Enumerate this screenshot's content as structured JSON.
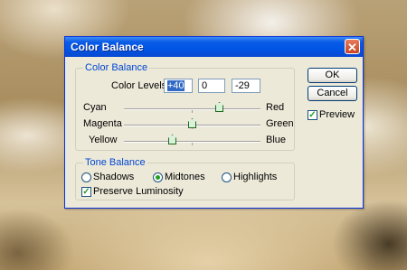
{
  "window": {
    "title": "Color Balance",
    "close_glyph": "✕"
  },
  "color_balance": {
    "legend": "Color Balance",
    "levels_label": "Color Levels:",
    "levels": [
      "+40",
      "0",
      "-29"
    ],
    "sliders": [
      {
        "left": "Cyan",
        "right": "Red",
        "value": 40
      },
      {
        "left": "Magenta",
        "right": "Green",
        "value": 0
      },
      {
        "left": "Yellow",
        "right": "Blue",
        "value": -29
      }
    ]
  },
  "tone_balance": {
    "legend": "Tone Balance",
    "options": [
      "Shadows",
      "Midtones",
      "Highlights"
    ],
    "selected": "Midtones",
    "preserve_luminosity": {
      "label": "Preserve Luminosity",
      "checked": true
    }
  },
  "buttons": {
    "ok": "OK",
    "cancel": "Cancel"
  },
  "preview": {
    "label": "Preview",
    "checked": true
  },
  "check_glyph": "✓"
}
